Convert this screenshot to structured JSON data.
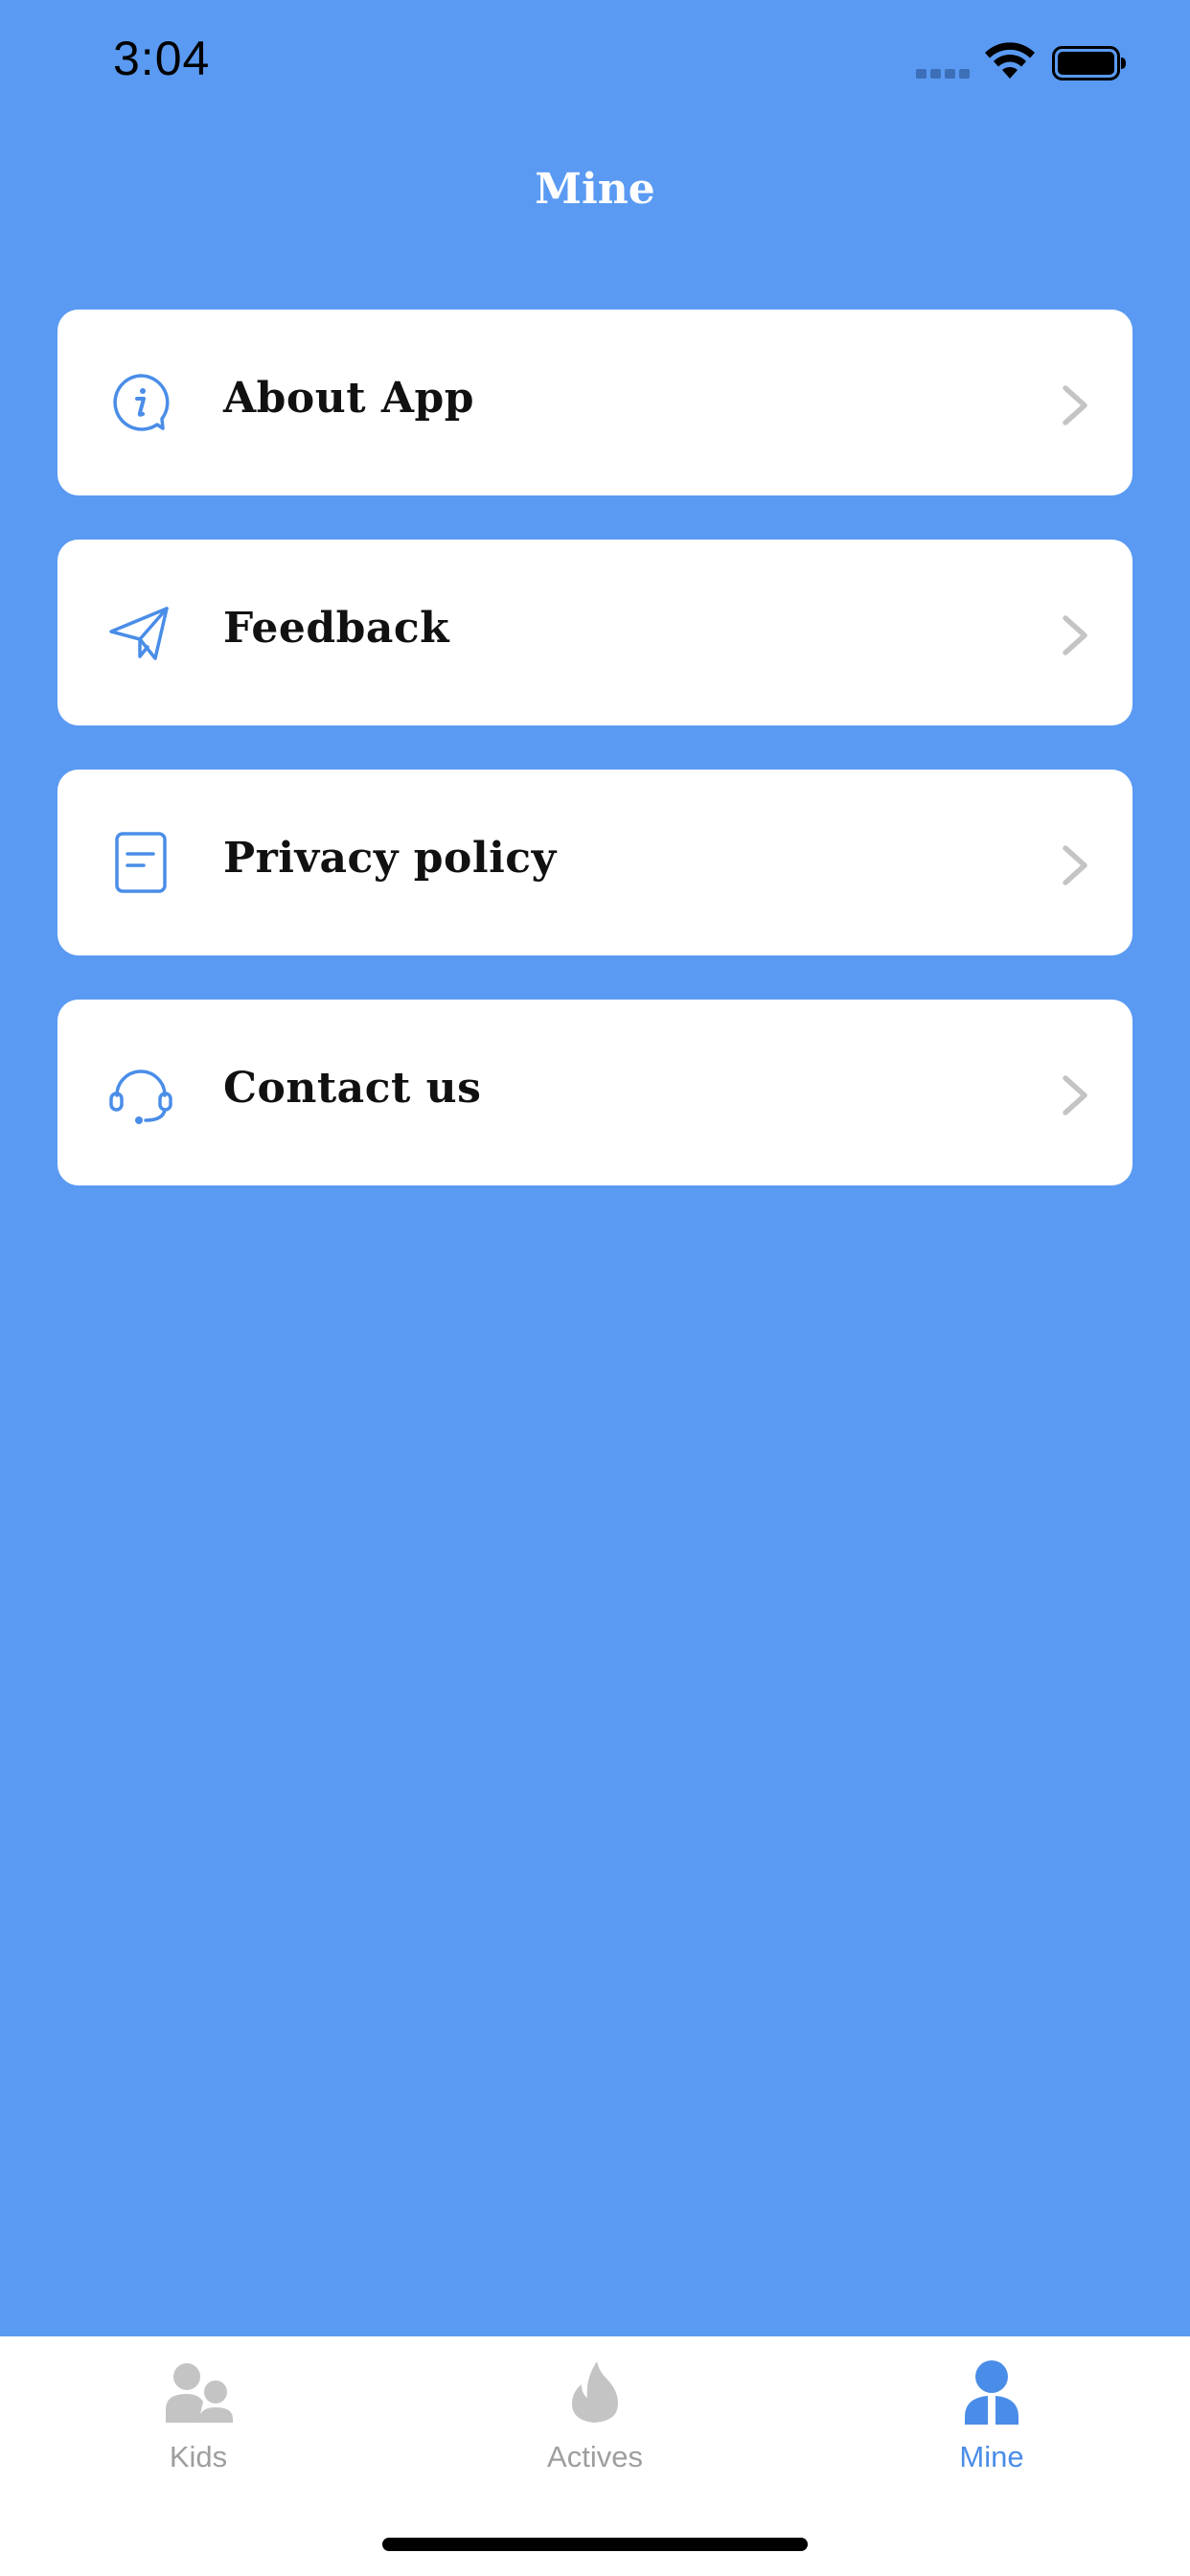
{
  "status_bar": {
    "time": "3:04"
  },
  "header": {
    "title": "Mine"
  },
  "menu": {
    "items": [
      {
        "label": "About App",
        "icon": "info-bubble-icon"
      },
      {
        "label": "Feedback",
        "icon": "paper-plane-icon"
      },
      {
        "label": "Privacy policy",
        "icon": "document-icon"
      },
      {
        "label": "Contact us",
        "icon": "headset-icon"
      }
    ]
  },
  "tab_bar": {
    "tabs": [
      {
        "label": "Kids",
        "icon": "people-icon",
        "active": false
      },
      {
        "label": "Actives",
        "icon": "flame-icon",
        "active": false
      },
      {
        "label": "Mine",
        "icon": "person-icon",
        "active": true
      }
    ]
  },
  "colors": {
    "background": "#5A9AF2",
    "accent": "#4A8DE8",
    "card": "#FFFFFF",
    "inactive_tab": "#9E9E9E"
  }
}
